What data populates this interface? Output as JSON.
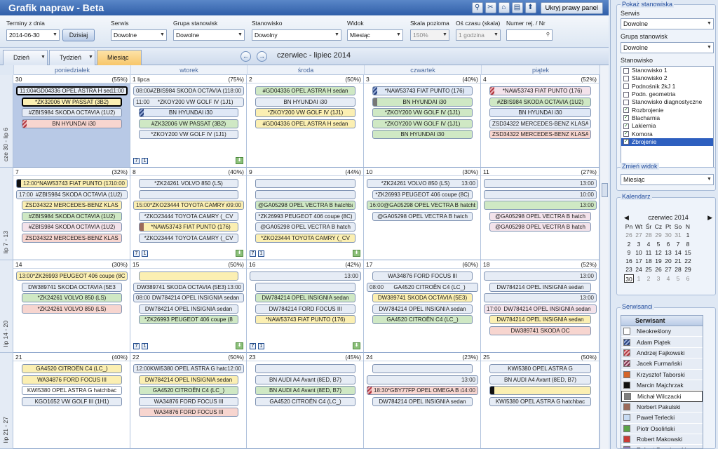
{
  "title": "Grafik napraw - Beta",
  "hide_panel": "Ukryj prawy panel",
  "filters": {
    "terms_label": "Terminy z dnia",
    "date": "2014-06-30",
    "today_btn": "Dzisiaj",
    "service_label": "Serwis",
    "service": "Dowolne",
    "group_label": "Grupa stanowisk",
    "group": "Dowolne",
    "station_label": "Stanowisko",
    "station": "Dowolny",
    "view_label": "Widok",
    "view": "Miesiąc",
    "hscale_label": "Skala pozioma",
    "hscale": "150%",
    "tscale_label": "Oś czasu (skala)",
    "tscale": "1 godzina",
    "reg_label": "Numer rej. / Nr",
    "reg": ""
  },
  "tabs": [
    "Dzień",
    "Tydzień",
    "Miesiąc"
  ],
  "range": "czerwiec - lipiec 2014",
  "weekdays": [
    "poniedziałek",
    "wtorek",
    "środa",
    "czwartek",
    "piątek"
  ],
  "weeks": [
    {
      "label": "cze 30 - lip 6",
      "days": [
        {
          "d": "30",
          "p": "(55%)",
          "today": true,
          "ev": [
            {
              "t1": "11:00",
              "n": "#GD04336 OPEL ASTRA H sedan",
              "t2": "11:00",
              "c": "#e6ecf5",
              "sel": true
            },
            {
              "n": "*ZK32006 VW PASSAT (3B2)",
              "c": "#fbefb2",
              "sel": true
            },
            {
              "n": "#ZBIS984 SKODA OCTAVIA (1U2)",
              "c": "#e6ecf5"
            },
            {
              "n": "BN HYUNDAI i30",
              "c": "#f7d5cf",
              "m": "mk-red"
            }
          ]
        },
        {
          "d": "1 lipca",
          "p": "(75%)",
          "cnt": [
            "7",
            "1"
          ],
          "ev": [
            {
              "t1": "08:00",
              "n": "#ZBIS984 SKODA OCTAVIA (1U2)",
              "t2": "18:00",
              "c": "#e6ecf5"
            },
            {
              "t1": "11:00",
              "n": "*ZKOY200 VW GOLF IV (1J1)",
              "t2": "",
              "c": "#e6ecf5"
            },
            {
              "n": "BN HYUNDAI i30",
              "c": "#dfe8f6",
              "m": "mk-navy"
            },
            {
              "n": "#ZK32006 VW PASSAT (3B2)",
              "c": "#cfe8c4"
            },
            {
              "n": "*ZKOY200 VW GOLF IV (1J1)",
              "c": "#e6ecf5"
            }
          ]
        },
        {
          "d": "2",
          "p": "(50%)",
          "ev": [
            {
              "n": "#GD04336 OPEL ASTRA H sedan",
              "c": "#cfe8c4"
            },
            {
              "n": "BN HYUNDAI i30",
              "c": "#e6ecf5"
            },
            {
              "n": "*ZKOY200 VW GOLF IV (1J1)",
              "c": "#fbefb2"
            },
            {
              "n": "#GD04336 OPEL ASTRA H sedan",
              "c": "#fbefb2"
            }
          ]
        },
        {
          "d": "3",
          "p": "(40%)",
          "ev": [
            {
              "n": "*NAW53743 FIAT PUNTO (176)",
              "c": "#dfe8f6",
              "m": "mk-navy"
            },
            {
              "n": "BN HYUNDAI i30",
              "c": "#cfe8c4",
              "m": "mk-grey"
            },
            {
              "n": "*ZKOY200 VW GOLF IV (1J1)",
              "c": "#cfe8c4"
            },
            {
              "n": "*ZKOY200 VW GOLF IV (1J1)",
              "c": "#cfe8c4"
            },
            {
              "n": "BN HYUNDAI i30",
              "c": "#cfe8c4"
            }
          ]
        },
        {
          "d": "4",
          "p": "(52%)",
          "ev": [
            {
              "n": "*NAW53743 FIAT PUNTO (176)",
              "c": "#f3e2ea",
              "m": "mk-red"
            },
            {
              "n": "#ZBIS984 SKODA OCTAVIA (1U2)",
              "c": "#cfe8c4"
            },
            {
              "n": "BN HYUNDAI i30",
              "c": "#dfe8f6"
            },
            {
              "n": "ZSD34322 MERCEDES-BENZ KLASA",
              "c": "#e6ecf5"
            },
            {
              "n": "ZSD34322 MERCEDES-BENZ KLASA",
              "c": "#f7d5cf"
            }
          ]
        }
      ]
    },
    {
      "label": "lip 7 - 13",
      "days": [
        {
          "d": "7",
          "p": "(32%)",
          "ev": [
            {
              "t1": "12:00",
              "n": "*NAW53743 FIAT PUNTO (176)",
              "t2": "10:00",
              "c": "#fbefb2",
              "m": "mk-black"
            },
            {
              "t1": "17:00",
              "n": "#ZBIS984 SKODA OCTAVIA (1U2)",
              "t2": "",
              "c": "#e6ecf5"
            },
            {
              "n": "ZSD34322 MERCEDES-BENZ KLAS",
              "c": "#fbefb2"
            },
            {
              "n": "#ZBIS984 SKODA OCTAVIA (1U2)",
              "c": "#cfe8c4"
            },
            {
              "n": "#ZBIS984 SKODA OCTAVIA (1U2)",
              "c": "#f3e2ea"
            },
            {
              "n": "ZSD34322 MERCEDES-BENZ KLAS",
              "c": "#f7d5cf"
            }
          ]
        },
        {
          "d": "8",
          "p": "(40%)",
          "cnt": [
            "7",
            "1"
          ],
          "ev": [
            {
              "n": "*ZK24261 VOLVO 850 (LS)",
              "c": "#e6ecf5"
            },
            {
              "n": "",
              "c": "#e6ecf5"
            },
            {
              "t1": "15:00",
              "n": "*ZKO23444 TOYOTA CAMRY (_CV2_, _XV2_)",
              "t2": "09:00",
              "c": "#fbefb2"
            },
            {
              "n": "*ZKO23444 TOYOTA CAMRY (_CV",
              "c": "#e6ecf5"
            },
            {
              "n": "*NAW53743 FIAT PUNTO (176)",
              "c": "#fbefb2",
              "m": "mk-brown"
            },
            {
              "n": "*ZKO23444 TOYOTA CAMRY (_CV",
              "c": "#e6ecf5"
            }
          ]
        },
        {
          "d": "9",
          "p": "(44%)",
          "cnt": [
            "7",
            "1"
          ],
          "ev": [
            {
              "n": "",
              "c": "#e6ecf5"
            },
            {
              "n": "",
              "c": "#e6ecf5"
            },
            {
              "n": "@GA05298 OPEL VECTRA B hatchback (38_)",
              "c": "#cfe8c4"
            },
            {
              "n": "*ZK26993 PEUGEOT 406 coupe (8C)",
              "c": "#e6ecf5"
            },
            {
              "n": "@GA05298 OPEL VECTRA B hatch",
              "c": "#e6ecf5"
            },
            {
              "n": "*ZKO23444 TOYOTA CAMRY (_CV",
              "c": "#fbefb2"
            }
          ]
        },
        {
          "d": "10",
          "p": "(30%)",
          "ev": [
            {
              "n": "*ZK24261 VOLVO 850 (LS)",
              "t2": "13:00",
              "c": "#e6ecf5"
            },
            {
              "n": "*ZK26993 PEUGEOT 406 coupe (8C)",
              "c": "#e6ecf5"
            },
            {
              "t1": "16:00",
              "n": "@GA05298 OPEL VECTRA B hatchback (38_)",
              "t2": "",
              "c": "#cfe8c4"
            },
            {
              "n": "@GA05298 OPEL VECTRA B hatch",
              "c": "#e6ecf5"
            }
          ]
        },
        {
          "d": "11",
          "p": "(27%)",
          "ev": [
            {
              "n": "",
              "t2": "13:00",
              "c": "#e6ecf5"
            },
            {
              "n": "",
              "t2": "10:00",
              "c": "#e6ecf5"
            },
            {
              "n": "",
              "t2": "13:00",
              "c": "#cfe8c4"
            },
            {
              "n": "@GA05298 OPEL VECTRA B hatch",
              "c": "#f3e2ea"
            },
            {
              "n": "@GA05298 OPEL VECTRA B hatch",
              "c": "#f3e2ea"
            }
          ]
        }
      ]
    },
    {
      "label": "lip 14 - 20",
      "days": [
        {
          "d": "14",
          "p": "(30%)",
          "ev": [
            {
              "t1": "13:00",
              "n": "*ZK26993 PEUGEOT 406 coupe (8C)",
              "t2": "",
              "c": "#fbefb2"
            },
            {
              "n": "DW389741 SKODA OCTAVIA (5E3",
              "c": "#e6ecf5"
            },
            {
              "n": "*ZK24261 VOLVO 850 (LS)",
              "c": "#cfe8c4"
            },
            {
              "n": "*ZK24261 VOLVO 850 (LS)",
              "c": "#f7d5cf"
            }
          ]
        },
        {
          "d": "15",
          "p": "(50%)",
          "cnt": [
            "7",
            "1"
          ],
          "ev": [
            {
              "n": "",
              "c": "#fbefb2"
            },
            {
              "n": "DW389741 SKODA OCTAVIA (5E3)",
              "t2": "13:00",
              "c": "#e6ecf5"
            },
            {
              "t1": "08:00",
              "n": "DW784214 OPEL INSIGNIA sedan",
              "t2": "",
              "c": "#e6ecf5"
            },
            {
              "n": "DW784214 OPEL INSIGNIA sedan",
              "c": "#e6ecf5"
            },
            {
              "n": "*ZK26993 PEUGEOT 406 coupe (8",
              "c": "#cfe8c4"
            }
          ]
        },
        {
          "d": "16",
          "p": "(42%)",
          "cnt": [
            "7",
            "1"
          ],
          "ev": [
            {
              "n": "",
              "t2": "13:00",
              "c": "#e6ecf5"
            },
            {
              "n": "",
              "c": "#e6ecf5"
            },
            {
              "n": "DW784214 OPEL INSIGNIA sedan",
              "c": "#cfe8c4"
            },
            {
              "n": "DW784214 FORD FOCUS III",
              "c": "#e6ecf5"
            },
            {
              "n": "*NAW53743 FIAT PUNTO (176)",
              "c": "#fbefb2"
            }
          ]
        },
        {
          "d": "17",
          "p": "(60%)",
          "ev": [
            {
              "n": "WA34876 FORD FOCUS III",
              "c": "#e6ecf5"
            },
            {
              "t1": "08:00",
              "n": "GA4520 CITROËN C4 (LC_)",
              "t2": "",
              "c": "#e6ecf5"
            },
            {
              "n": "DW389741 SKODA OCTAVIA (5E3)",
              "c": "#fbefb2"
            },
            {
              "n": "DW784214 OPEL INSIGNIA sedan",
              "c": "#e6ecf5"
            },
            {
              "n": "GA4520 CITROËN C4 (LC_)",
              "c": "#cfe8c4"
            }
          ]
        },
        {
          "d": "18",
          "p": "(52%)",
          "ev": [
            {
              "n": "",
              "t2": "13:00",
              "c": "#e6ecf5"
            },
            {
              "n": "DW784214 OPEL INSIGNIA sedan",
              "c": "#e6ecf5"
            },
            {
              "n": "",
              "t2": "13:00",
              "c": "#e6ecf5"
            },
            {
              "t1": "17:00",
              "n": "DW784214 OPEL INSIGNIA sedan",
              "t2": "",
              "c": "#f3e2ea"
            },
            {
              "n": "DW784214 OPEL INSIGNIA sedan",
              "c": "#fbefb2"
            },
            {
              "n": "DW389741 SKODA OC",
              "c": "#f7d5cf"
            }
          ]
        }
      ]
    },
    {
      "label": "lip 21 - 27",
      "days": [
        {
          "d": "21",
          "p": "(40%)",
          "ev": [
            {
              "n": "GA4520 CITROËN C4 (LC_)",
              "c": "#fbefb2"
            },
            {
              "n": "WA34876 FORD FOCUS III",
              "c": "#fbefb2"
            },
            {
              "n": "KWI5380 OPEL ASTRA G hatchbac",
              "c": "#fff"
            },
            {
              "n": "KGO1652 VW GOLF III (1H1)",
              "c": "#e6ecf5"
            }
          ]
        },
        {
          "d": "22",
          "p": "(50%)",
          "ev": [
            {
              "t1": "12:00",
              "n": "KWI5380 OPEL ASTRA G hatchback (F48_, F08_)",
              "t2": "12:00",
              "c": "#e6ecf5"
            },
            {
              "n": "DW784214 OPEL INSIGNIA sedan",
              "c": "#fbefb2"
            },
            {
              "n": "GA4520 CITROËN C4 (LC_)",
              "c": "#cfe8c4"
            },
            {
              "n": "WA34876 FORD FOCUS III",
              "c": "#e6ecf5"
            },
            {
              "n": "WA34876 FORD FOCUS III",
              "c": "#f7d5cf"
            }
          ]
        },
        {
          "d": "23",
          "p": "(45%)",
          "ev": [
            {
              "n": "",
              "c": "#e6ecf5"
            },
            {
              "n": "BN AUDI A4 Avant (8ED, B7)",
              "c": "#e6ecf5"
            },
            {
              "n": "BN AUDI A4 Avant (8ED, B7)",
              "c": "#cfe8c4"
            },
            {
              "n": "GA4520 CITROËN C4 (LC_)",
              "c": "#e6ecf5"
            }
          ]
        },
        {
          "d": "24",
          "p": "(23%)",
          "ev": [
            {
              "n": "",
              "c": "#e6ecf5"
            },
            {
              "n": "",
              "t2": "13:00",
              "c": "#e6ecf5"
            },
            {
              "t1": "18:30",
              "n": "*GBY77FP OPEL OMEGA B (25_, 26_, 27_)",
              "t2": "14:00",
              "c": "#f7d5cf",
              "m": "mk-red"
            },
            {
              "n": "DW784214 OPEL INSIGNIA sedan",
              "c": "#e6ecf5"
            }
          ]
        },
        {
          "d": "25",
          "p": "(50%)",
          "ev": [
            {
              "n": "KWI5380 OPEL ASTRA G",
              "c": "#e6ecf5"
            },
            {
              "n": "BN AUDI A4 Avant (8ED, B7)",
              "c": "#e6ecf5"
            },
            {
              "n": "",
              "c": "#fbefb2",
              "m": "mk-black"
            },
            {
              "n": "KWI5380 OPEL ASTRA G hatchbac",
              "c": "#e6ecf5"
            }
          ]
        }
      ]
    }
  ],
  "side": {
    "show_title": "Pokaż stanowiska",
    "service_label": "Serwis",
    "service": "Dowolne",
    "group_label": "Grupa stanowisk",
    "group": "Dowolne",
    "station_label": "Stanowisko",
    "stations": [
      {
        "n": "Stanowisko 1",
        "c": false
      },
      {
        "n": "Stanowisko 2",
        "c": false
      },
      {
        "n": "Podnośnik 2kJ 1",
        "c": false
      },
      {
        "n": "Podn. geometria",
        "c": false
      },
      {
        "n": "Stanowisko diagnostyczne",
        "c": false
      },
      {
        "n": "Rozbrojenie",
        "c": true
      },
      {
        "n": "Blacharnia",
        "c": true
      },
      {
        "n": "Lakiernia",
        "c": true
      },
      {
        "n": "Komora",
        "c": true
      },
      {
        "n": "Zbrojenie",
        "c": true,
        "hl": true
      }
    ],
    "view_title": "Zmień widok",
    "view": "Miesiąc",
    "cal_title": "Kalendarz",
    "cal_month": "czerwiec 2014",
    "cal_days": [
      "Pn",
      "Wt",
      "Śr",
      "Cz",
      "Pt",
      "So",
      "N"
    ],
    "cal_rows": [
      [
        "26",
        "27",
        "28",
        "29",
        "30",
        "31",
        "1"
      ],
      [
        "2",
        "3",
        "4",
        "5",
        "6",
        "7",
        "8"
      ],
      [
        "9",
        "10",
        "11",
        "12",
        "13",
        "14",
        "15"
      ],
      [
        "16",
        "17",
        "18",
        "19",
        "20",
        "21",
        "22"
      ],
      [
        "23",
        "24",
        "25",
        "26",
        "27",
        "28",
        "29"
      ],
      [
        "30",
        "1",
        "2",
        "3",
        "4",
        "5",
        "6"
      ]
    ],
    "serv_title": "Serwisanci",
    "serv_head": "Serwisant",
    "servicemen": [
      {
        "n": "Nieokreślony",
        "s": "#ffffff"
      },
      {
        "n": "Adam Piątek",
        "s": "repeating-linear-gradient(135deg,#243e7a 0 2px,#93a8d4 2px 4px)"
      },
      {
        "n": "Andrzej Fajkowski",
        "s": "repeating-linear-gradient(135deg,#b0323a 0 2px,#e8b0b5 2px 4px)"
      },
      {
        "n": "Jacek Furmański",
        "s": "repeating-linear-gradient(135deg,#7b2c46 0 2px,#d9b2c0 2px 4px)"
      },
      {
        "n": "Krzysztof Taborski",
        "s": "#d5652a"
      },
      {
        "n": "Marcin Majchrzak",
        "s": "#111111"
      },
      {
        "n": "Michał Wilczacki",
        "s": "#7e7e7e",
        "act": true
      },
      {
        "n": "Norbert Pakulski",
        "s": "#9b6a5a"
      },
      {
        "n": "Paweł Terlecki",
        "s": "#c7dbf3"
      },
      {
        "n": "Piotr Osoliński",
        "s": "#5aa347"
      },
      {
        "n": "Robert Makowski",
        "s": "#c93b36"
      },
      {
        "n": "Robert Szeniewski",
        "s": "#8f77b8"
      }
    ]
  }
}
